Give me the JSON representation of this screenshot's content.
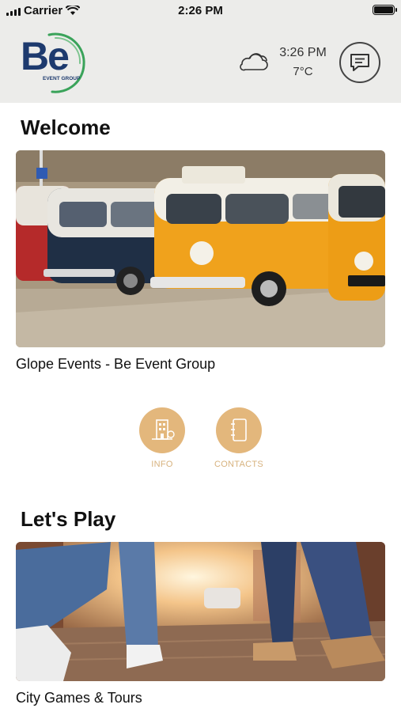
{
  "status_bar": {
    "carrier": "Carrier",
    "time": "2:26 PM"
  },
  "header": {
    "logo_text": "Be",
    "logo_subtext": "EVENT GROUP",
    "weather_time": "3:26 PM",
    "weather_temp": "7°C",
    "icons": {
      "weather": "cloud-icon",
      "chat": "chat-icon"
    }
  },
  "welcome": {
    "title": "Welcome",
    "image": "vw-vans-illustration",
    "caption": "Glope Events - Be Event Group",
    "buttons": [
      {
        "label": "INFO",
        "icon": "building-info-icon"
      },
      {
        "label": "CONTACTS",
        "icon": "address-book-icon"
      }
    ]
  },
  "play": {
    "title": "Let's Play",
    "image": "street-legs-photo",
    "caption": "City Games & Tours"
  },
  "colors": {
    "accent": "#e3b77c",
    "accent_text": "#d7b27e",
    "logo_blue": "#1d3a6e",
    "header_bg": "#ececea"
  }
}
